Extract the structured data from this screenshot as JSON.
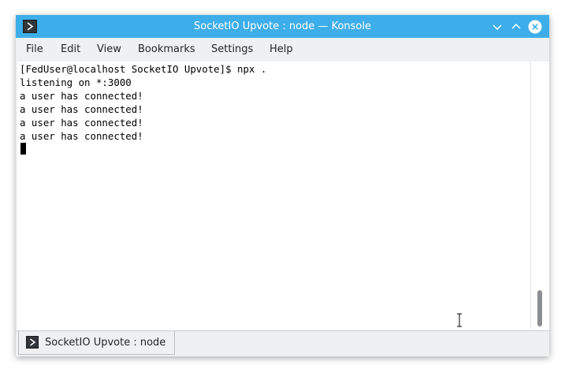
{
  "window": {
    "title": "SocketIO Upvote : node — Konsole",
    "accent_color": "#3daee9"
  },
  "titlebar_buttons": [
    {
      "icon": "minimize-icon"
    },
    {
      "icon": "maximize-icon"
    },
    {
      "icon": "close-icon"
    }
  ],
  "menubar": {
    "items": [
      "File",
      "Edit",
      "View",
      "Bookmarks",
      "Settings",
      "Help"
    ]
  },
  "terminal": {
    "lines": [
      "[FedUser@localhost SocketIO Upvote]$ npx .",
      "listening on *:3000",
      "a user has connected!",
      "a user has connected!",
      "a user has connected!",
      "a user has connected!"
    ]
  },
  "tabs": [
    {
      "label": "SocketIO Upvote : node",
      "icon": "terminal-icon"
    }
  ]
}
